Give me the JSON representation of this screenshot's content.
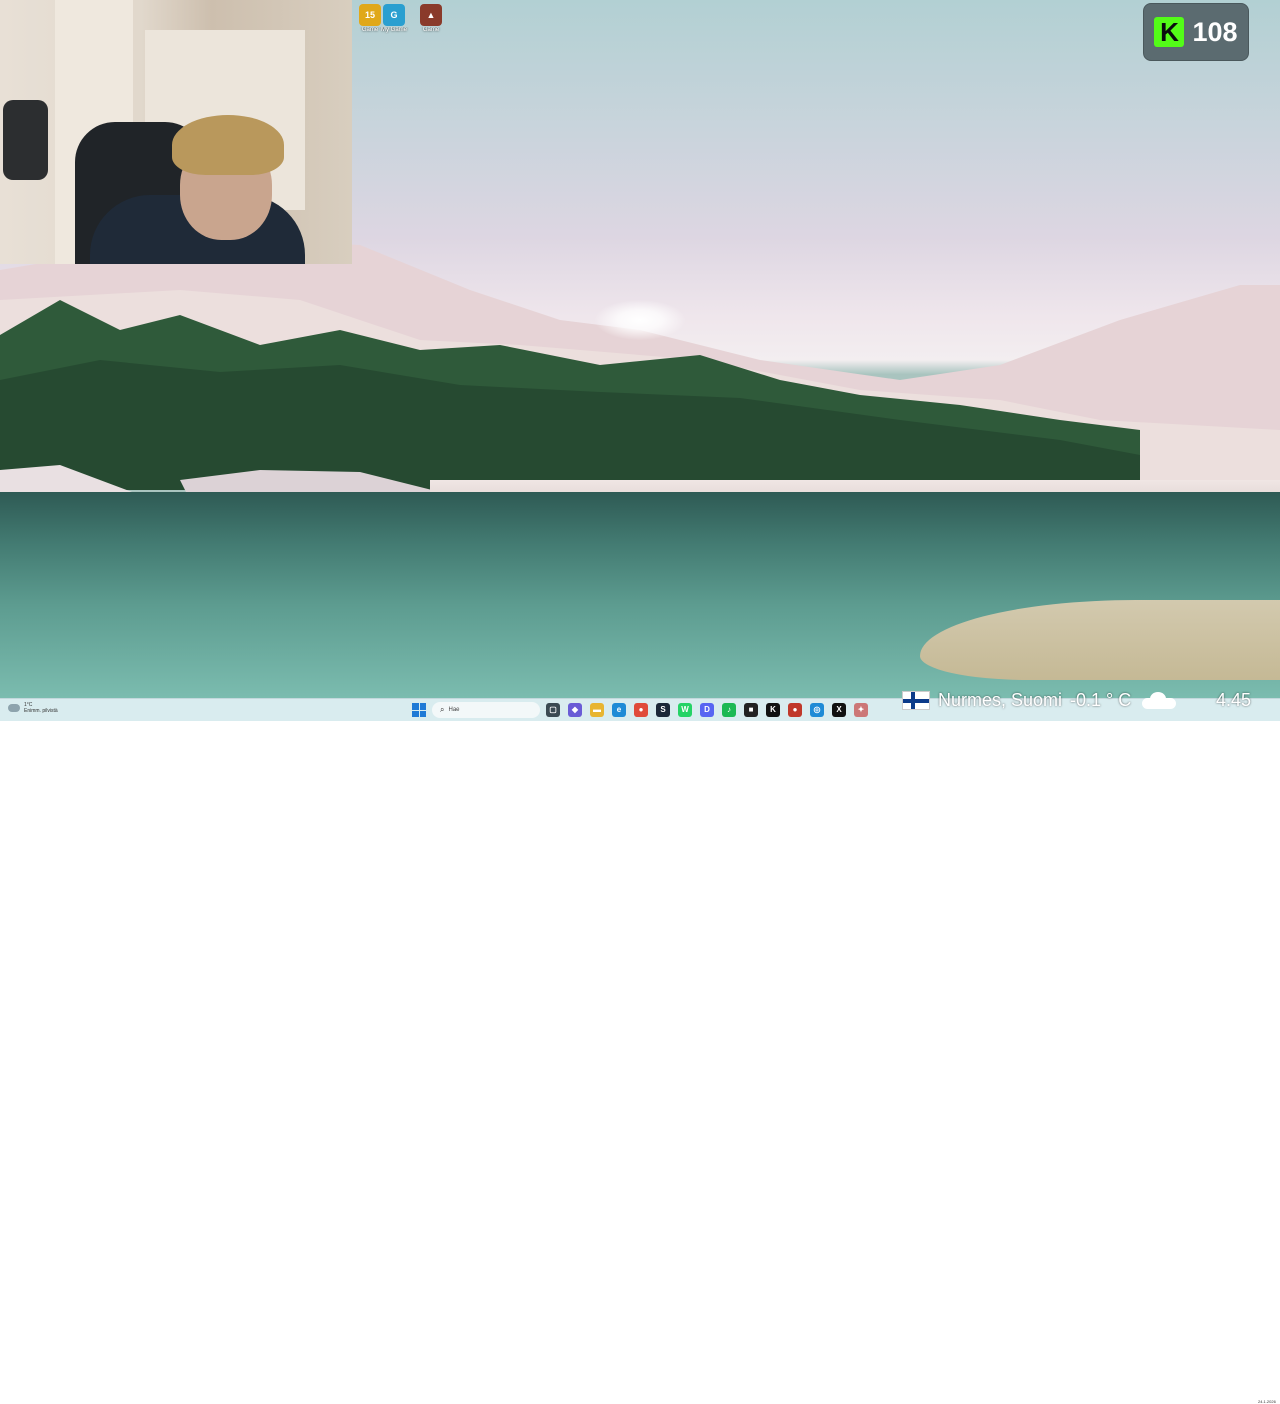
{
  "desktop": {
    "wallpaper": "lake-forest-snow-landscape",
    "icons": [
      {
        "name": "game-icon-1",
        "label": "Game",
        "color": "#e0a81a",
        "glyph": "15"
      },
      {
        "name": "game-icon-2",
        "label": "My Game",
        "color": "#2a9fd0",
        "glyph": "G"
      },
      {
        "name": "game-icon-3",
        "label": "Game",
        "color": "#8a3a2a",
        "glyph": "▲"
      }
    ]
  },
  "stream_overlay": {
    "viewer_count": "108",
    "platform_icon": "kick-logo",
    "location": "Nurmes, Suomi",
    "temperature": "-0.1 ° C",
    "time": "4.45",
    "accent_color": "#53fc18"
  },
  "taskbar": {
    "weather": {
      "temp": "1°C",
      "desc": "Enimm. pilvistä"
    },
    "search_placeholder": "Hae",
    "apps": [
      {
        "name": "task-view-icon",
        "glyph": "▢",
        "color": "#3b4a52"
      },
      {
        "name": "copilot-icon",
        "glyph": "◆",
        "color": "#6a5cd6"
      },
      {
        "name": "file-explorer-icon",
        "glyph": "▬",
        "color": "#e8b530"
      },
      {
        "name": "edge-icon",
        "glyph": "e",
        "color": "#1f8bd6"
      },
      {
        "name": "chrome-icon",
        "glyph": "●",
        "color": "#e04b3a"
      },
      {
        "name": "steam-icon",
        "glyph": "S",
        "color": "#1b2838"
      },
      {
        "name": "whatsapp-icon",
        "glyph": "W",
        "color": "#25d366"
      },
      {
        "name": "discord-icon",
        "glyph": "D",
        "color": "#5865f2"
      },
      {
        "name": "spotify-icon",
        "glyph": "♪",
        "color": "#1db954"
      },
      {
        "name": "app-icon",
        "glyph": "■",
        "color": "#222222"
      },
      {
        "name": "kick-app-icon",
        "glyph": "K",
        "color": "#111111"
      },
      {
        "name": "obs-icon",
        "glyph": "●",
        "color": "#c0392b"
      },
      {
        "name": "browser-icon",
        "glyph": "◎",
        "color": "#1f8bd6"
      },
      {
        "name": "capcut-icon",
        "glyph": "X",
        "color": "#111111"
      },
      {
        "name": "extra-icon",
        "glyph": "✦",
        "color": "#c77"
      }
    ],
    "date": "24.1.2026"
  }
}
